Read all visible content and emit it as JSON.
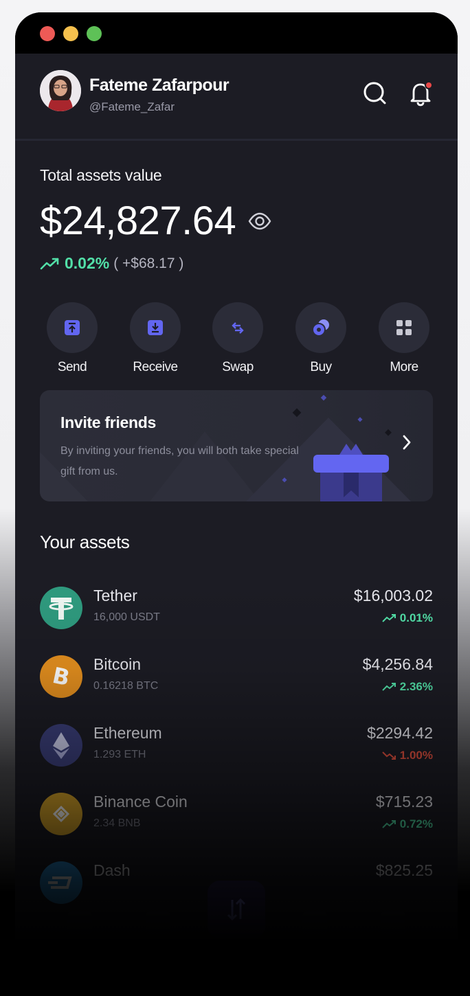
{
  "window": {
    "controls": [
      "close",
      "minimize",
      "zoom"
    ]
  },
  "header": {
    "user_name": "Fateme Zafarpour",
    "user_handle": "@Fateme_Zafar",
    "icons": [
      "search-icon",
      "bell-icon"
    ]
  },
  "balance": {
    "label": "Total assets value",
    "value": "$24,827.64",
    "change_pct": "0.02%",
    "change_abs": "( +$68.17 )"
  },
  "actions": [
    {
      "label": "Send",
      "icon": "send-icon"
    },
    {
      "label": "Receive",
      "icon": "receive-icon"
    },
    {
      "label": "Swap",
      "icon": "swap-icon"
    },
    {
      "label": "Buy",
      "icon": "buy-icon"
    },
    {
      "label": "More",
      "icon": "grid-icon"
    }
  ],
  "invite": {
    "title": "Invite friends",
    "description": "By inviting your friends, you will both take special gift from us."
  },
  "assets_title": "Your assets",
  "assets": [
    {
      "name": "Tether",
      "amount": "16,000 USDT",
      "value": "$16,003.02",
      "change": "0.01%",
      "direction": "up"
    },
    {
      "name": "Bitcoin",
      "amount": "0.16218 BTC",
      "value": "$4,256.84",
      "change": "2.36%",
      "direction": "up"
    },
    {
      "name": "Ethereum",
      "amount": "1.293 ETH",
      "value": "$2294.42",
      "change": "1.00%",
      "direction": "down"
    },
    {
      "name": "Binance Coin",
      "amount": "2.34 BNB",
      "value": "$715.23",
      "change": "0.72%",
      "direction": "up"
    },
    {
      "name": "Dash",
      "amount": "",
      "value": "$825.25",
      "change": "",
      "direction": "down"
    }
  ],
  "colors": {
    "up": "#52e0a8",
    "down": "#e0503f",
    "accent": "#5d5ff0",
    "background": "#1c1c24",
    "tether": "#2f9b7f",
    "bitcoin": "#e5901f",
    "ethereum": "#3b3f7a",
    "binance": "#d9a62a",
    "dash": "#2a8fd6"
  }
}
